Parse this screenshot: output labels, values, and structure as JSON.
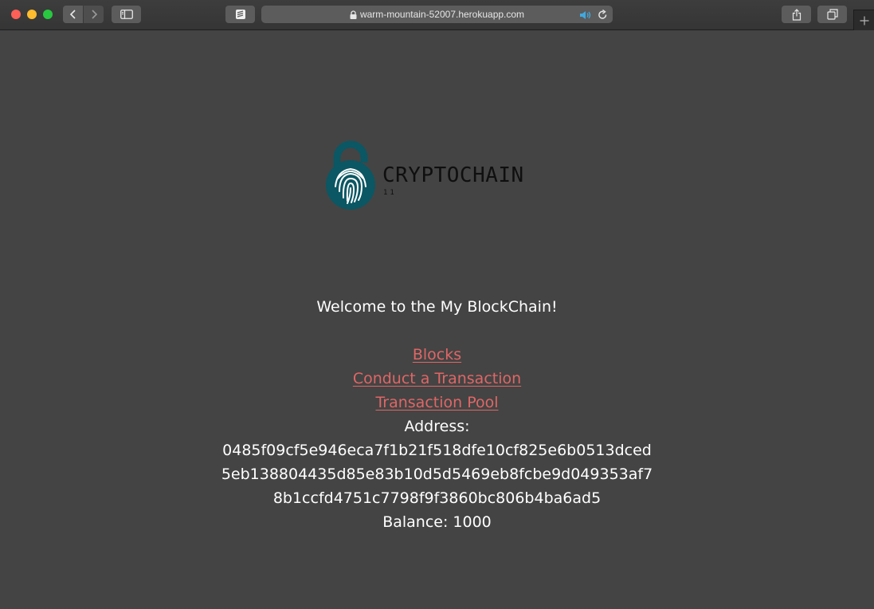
{
  "browser": {
    "url": "warm-mountain-52007.herokuapp.com"
  },
  "page": {
    "logo": {
      "brand": "CRYPTOCHAIN",
      "sub": "11"
    },
    "welcome": "Welcome to the My BlockChain!",
    "links": {
      "blocks": "Blocks",
      "conduct_transaction": "Conduct a Transaction",
      "transaction_pool": "Transaction Pool"
    },
    "address_label": "Address:",
    "address_lines": [
      "0485f09cf5e946eca7f1b21f518dfe10cf825e6b0513dced",
      "5eb138804435d85e83b10d5d5469eb8fcbe9d049353af7",
      "8b1ccfd4751c7798f9f3860bc806b4ba6ad5"
    ],
    "balance": "Balance: 1000"
  },
  "colors": {
    "background": "#444444",
    "link": "#e06666",
    "text": "#ffffff",
    "logo_teal": "#0b5763"
  }
}
